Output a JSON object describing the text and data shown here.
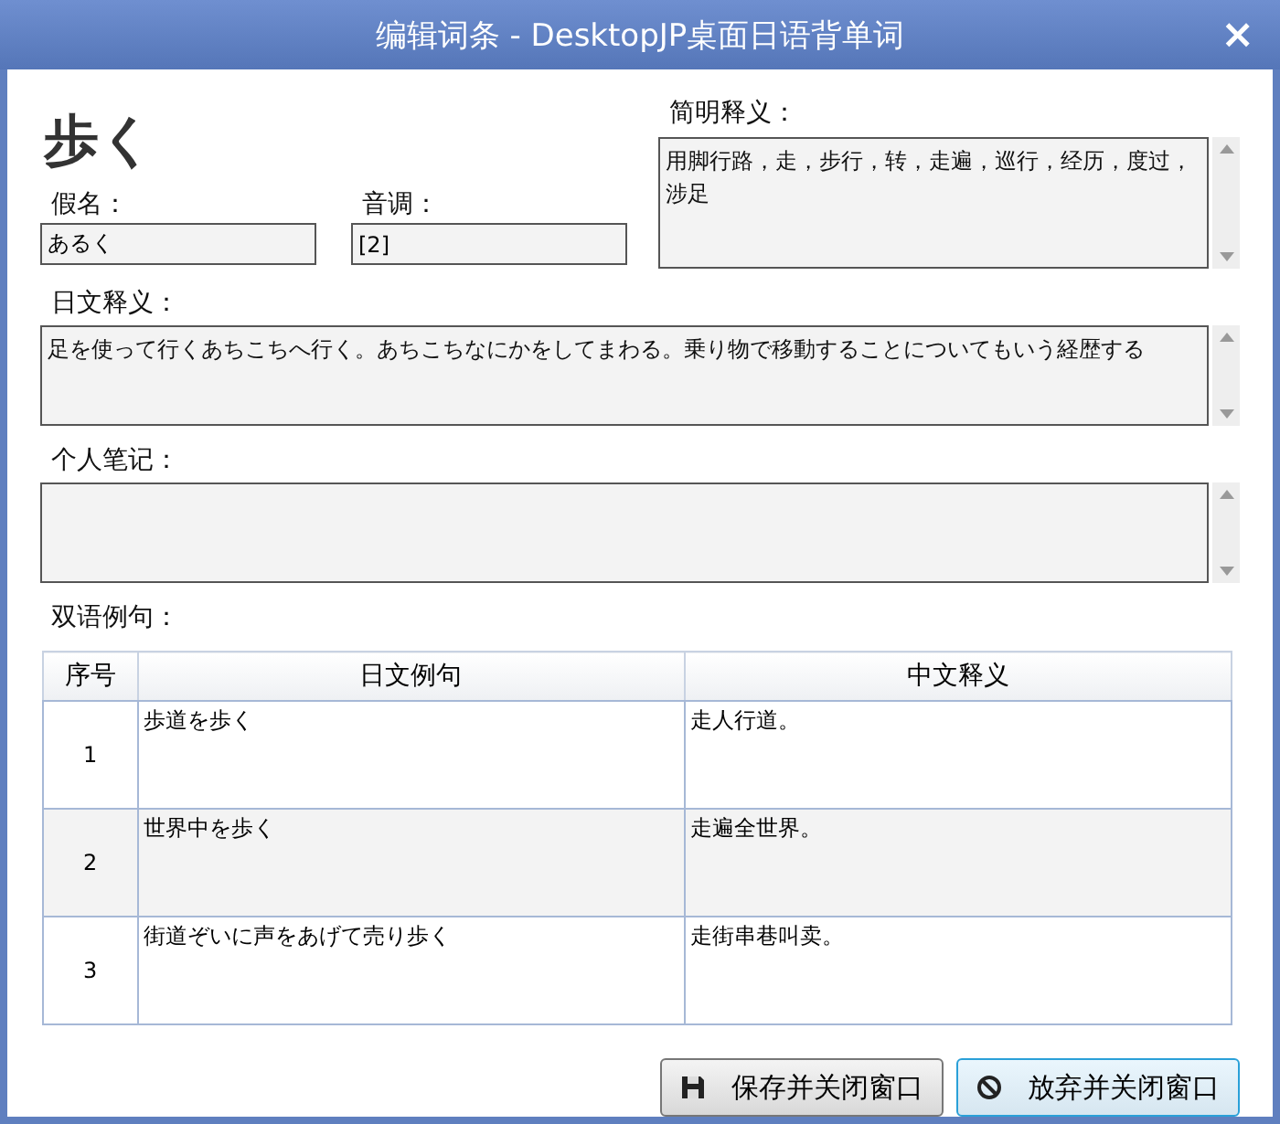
{
  "window": {
    "title": "编辑词条 - DesktopJP桌面日语背单词",
    "close": "×"
  },
  "word": "歩く",
  "kana": {
    "label": "假名：",
    "value": "あるく"
  },
  "accent": {
    "label": "音调：",
    "value": "[2]"
  },
  "brief": {
    "label": "简明释义：",
    "value": "用脚行路，走，步行，转，走遍，巡行，经历，度过，涉足"
  },
  "japanese": {
    "label": "日文释义：",
    "value": "足を使って行くあちこちへ行く。あちこちなにかをしてまわる。乗り物で移動することについてもいう経歴する"
  },
  "notes": {
    "label": "个人笔记："
  },
  "examples": {
    "label": "双语例句：",
    "columns": [
      "序号",
      "日文例句",
      "中文释义"
    ],
    "rows": [
      {
        "index": "1",
        "japanese": "歩道を歩く",
        "chinese": "走人行道。"
      },
      {
        "index": "2",
        "japanese": "世界中を歩く",
        "chinese": "走遍全世界。"
      },
      {
        "index": "3",
        "japanese": "街道ぞいに声をあげて売り歩く",
        "chinese": "走街串巷叫卖。"
      }
    ]
  },
  "buttons": [
    {
      "kind": "save",
      "label": "保存并关闭窗口",
      "focused": false
    },
    {
      "kind": "cancel",
      "label": "放弃并关闭窗口",
      "focused": true
    }
  ]
}
